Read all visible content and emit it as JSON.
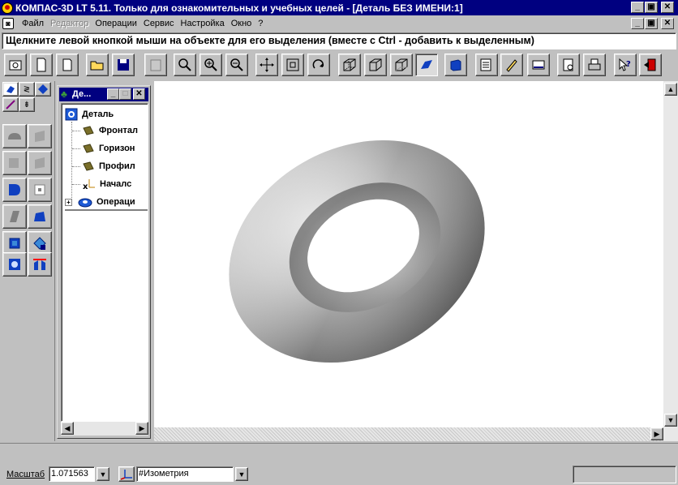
{
  "window": {
    "title": "КОМПАС-3D LT 5.11. Только для ознакомительных и учебных целей - [Деталь БЕЗ ИМЕНИ:1]",
    "caption_buttons": [
      "_",
      "▣",
      "✕"
    ]
  },
  "menu": {
    "items": [
      {
        "label": "Файл",
        "disabled": false
      },
      {
        "label": "Редактор",
        "disabled": true
      },
      {
        "label": "Операции",
        "disabled": false
      },
      {
        "label": "Сервис",
        "disabled": false
      },
      {
        "label": "Настройка",
        "disabled": false
      },
      {
        "label": "Окно",
        "disabled": false
      },
      {
        "label": "?",
        "disabled": false
      }
    ]
  },
  "hint": "Щелкните левой кнопкой мыши на объекте для его выделения (вместе с Ctrl - добавить к выделенным)",
  "toolbar": {
    "buttons": [
      "camera-icon",
      "new-sheet-icon",
      "new-doc-icon",
      "open-folder-icon",
      "save-icon",
      "paste-icon",
      "zoom-window-icon",
      "zoom-in-icon",
      "zoom-out-icon",
      "pan-icon",
      "show-all-icon",
      "rotate-icon",
      "wireframe-icon",
      "hidden-lines-icon",
      "thin-hidden-icon",
      "shaded-icon",
      "perspective-icon",
      "properties-icon",
      "library-icon",
      "display-icon",
      "print-preview-icon",
      "print-icon",
      "help-icon",
      "exit-icon"
    ],
    "pressed": "shaded-icon"
  },
  "palette": {
    "tabs": [
      "part-mode-tab",
      "sketch-mode-tab",
      "edit-mode-tab",
      "line-tab",
      "dimension-tab"
    ],
    "tools": [
      "extrude-icon",
      "extrude-dim-icon",
      "rotate-body-icon",
      "rotate-dim-icon",
      "loft-icon",
      "loft-dim-icon",
      "kinematic-icon",
      "hole-icon",
      "fillet-icon",
      "chamfer-icon",
      "shell-icon",
      "slope-icon",
      "array-icon",
      "mirror-icon"
    ]
  },
  "tree": {
    "caption": "Де...",
    "buttons": [
      "_",
      "□",
      "✕"
    ],
    "root": "Деталь",
    "nodes": [
      "Фронтальная плоскость",
      "Горизонтальная плоскость",
      "Профильная плоскость",
      "Начало координат",
      "Операция вращения"
    ],
    "node_labels_visible": [
      "Фронтал",
      "Горизон",
      "Профил",
      "Началс",
      "Операци"
    ]
  },
  "statusbar": {
    "scale_label": "Масштаб",
    "scale_value": "1.071563",
    "orientation_value": "#Изометрия"
  },
  "colors": {
    "titlebar": "#000080",
    "face": "#c0c0c0",
    "torus_light": "#d8d8d8",
    "torus_dark": "#3f3f3f"
  }
}
